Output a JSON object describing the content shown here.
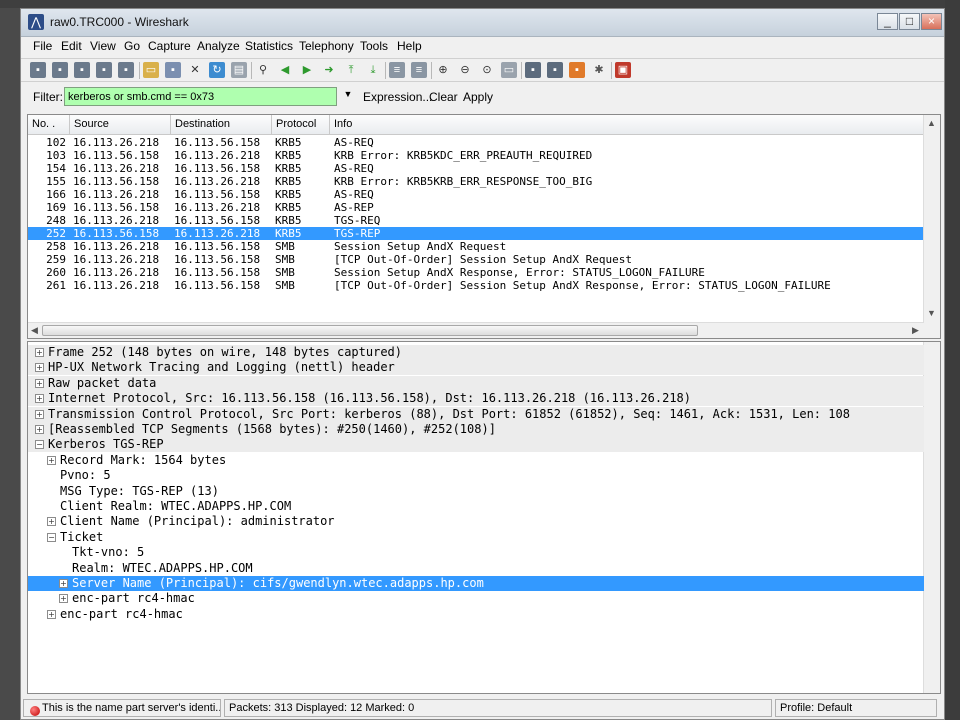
{
  "window": {
    "title": "raw0.TRC000 - Wireshark"
  },
  "menu": [
    "File",
    "Edit",
    "View",
    "Go",
    "Capture",
    "Analyze",
    "Statistics",
    "Telephony",
    "Tools",
    "Help"
  ],
  "filter": {
    "label": "Filter:",
    "value": "kerberos or smb.cmd == 0x73",
    "expression_label": "Expression...",
    "clear_label": "Clear",
    "apply_label": "Apply",
    "color": "#afffaf"
  },
  "packet_list": {
    "columns": [
      "No. .",
      "Source",
      "Destination",
      "Protocol",
      "Info"
    ],
    "rows": [
      {
        "no": "102",
        "src": "16.113.26.218",
        "dst": "16.113.56.158",
        "proto": "KRB5",
        "info": "AS-REQ"
      },
      {
        "no": "103",
        "src": "16.113.56.158",
        "dst": "16.113.26.218",
        "proto": "KRB5",
        "info": "KRB Error: KRB5KDC_ERR_PREAUTH_REQUIRED"
      },
      {
        "no": "154",
        "src": "16.113.26.218",
        "dst": "16.113.56.158",
        "proto": "KRB5",
        "info": "AS-REQ"
      },
      {
        "no": "155",
        "src": "16.113.56.158",
        "dst": "16.113.26.218",
        "proto": "KRB5",
        "info": "KRB Error: KRB5KRB_ERR_RESPONSE_TOO_BIG"
      },
      {
        "no": "166",
        "src": "16.113.26.218",
        "dst": "16.113.56.158",
        "proto": "KRB5",
        "info": "AS-REQ"
      },
      {
        "no": "169",
        "src": "16.113.56.158",
        "dst": "16.113.26.218",
        "proto": "KRB5",
        "info": "AS-REP"
      },
      {
        "no": "248",
        "src": "16.113.26.218",
        "dst": "16.113.56.158",
        "proto": "KRB5",
        "info": "TGS-REQ"
      },
      {
        "no": "252",
        "src": "16.113.56.158",
        "dst": "16.113.26.218",
        "proto": "KRB5",
        "info": "TGS-REP"
      },
      {
        "no": "258",
        "src": "16.113.26.218",
        "dst": "16.113.56.158",
        "proto": "SMB",
        "info": "Session Setup AndX Request"
      },
      {
        "no": "259",
        "src": "16.113.26.218",
        "dst": "16.113.56.158",
        "proto": "SMB",
        "info": "[TCP Out-Of-Order] Session Setup AndX Request"
      },
      {
        "no": "260",
        "src": "16.113.26.218",
        "dst": "16.113.56.158",
        "proto": "SMB",
        "info": "Session Setup AndX Response, Error: STATUS_LOGON_FAILURE"
      },
      {
        "no": "261",
        "src": "16.113.26.218",
        "dst": "16.113.56.158",
        "proto": "SMB",
        "info": "[TCP Out-Of-Order] Session Setup AndX Response, Error: STATUS_LOGON_FAILURE"
      }
    ],
    "selected_no": "252"
  },
  "detail": [
    {
      "level": 0,
      "exp": "+",
      "text": "Frame 252 (148 bytes on wire, 148 bytes captured)"
    },
    {
      "level": 0,
      "exp": "+",
      "text": "HP-UX Network Tracing and Logging (nettl) header"
    },
    {
      "level": 0,
      "exp": "+",
      "text": "Raw packet data"
    },
    {
      "level": 0,
      "exp": "+",
      "text": "Internet Protocol, Src: 16.113.56.158 (16.113.56.158), Dst: 16.113.26.218 (16.113.26.218)"
    },
    {
      "level": 0,
      "exp": "+",
      "text": "Transmission Control Protocol, Src Port: kerberos (88), Dst Port: 61852 (61852), Seq: 1461, Ack: 1531, Len: 108"
    },
    {
      "level": 0,
      "exp": "+",
      "text": "[Reassembled TCP Segments (1568 bytes): #250(1460), #252(108)]"
    },
    {
      "level": 0,
      "exp": "-",
      "text": "Kerberos TGS-REP"
    },
    {
      "level": 1,
      "exp": "+",
      "text": "Record Mark: 1564 bytes"
    },
    {
      "level": 1,
      "exp": "",
      "text": "Pvno: 5"
    },
    {
      "level": 1,
      "exp": "",
      "text": "MSG Type: TGS-REP (13)"
    },
    {
      "level": 1,
      "exp": "",
      "text": "Client Realm: WTEC.ADAPPS.HP.COM"
    },
    {
      "level": 1,
      "exp": "+",
      "text": "Client Name (Principal): administrator"
    },
    {
      "level": 1,
      "exp": "-",
      "text": "Ticket"
    },
    {
      "level": 2,
      "exp": "",
      "text": "Tkt-vno: 5"
    },
    {
      "level": 2,
      "exp": "",
      "text": "Realm: WTEC.ADAPPS.HP.COM"
    },
    {
      "level": 2,
      "exp": "+",
      "text": "Server Name (Principal): cifs/gwendlyn.wtec.adapps.hp.com",
      "selected": true
    },
    {
      "level": 2,
      "exp": "+",
      "text": "enc-part rc4-hmac"
    },
    {
      "level": 1,
      "exp": "+",
      "text": "enc-part rc4-hmac"
    }
  ],
  "status": {
    "hint": "This is the name part server's identi...",
    "packets": "Packets: 313 Displayed: 12 Marked: 0",
    "profile": "Profile: Default"
  },
  "selection_color": "#3399ff"
}
